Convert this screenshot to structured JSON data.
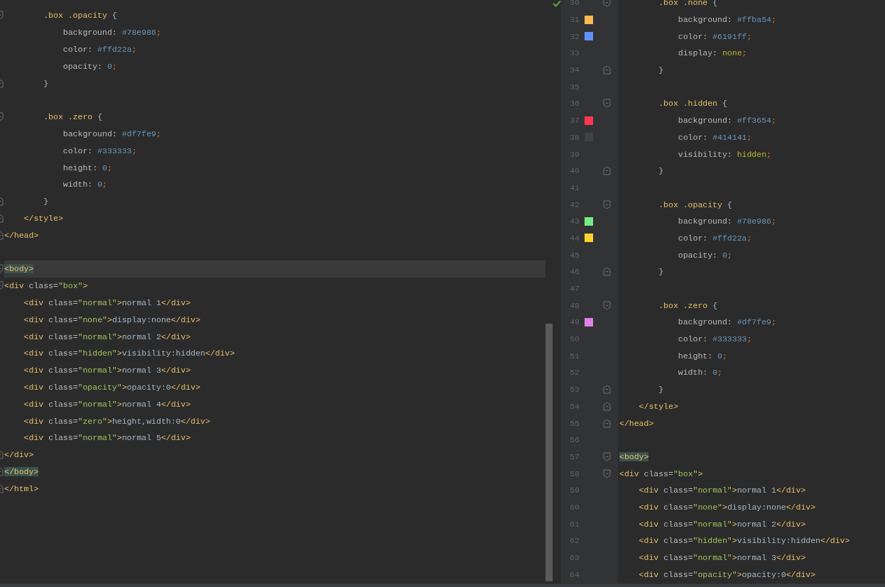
{
  "left_editor": {
    "lines": [
      {
        "kind": "opener",
        "current": false,
        "tokens": [
          {
            "kind": "sel",
            "text": "        .box .opacity"
          },
          {
            "kind": "text",
            "text": " {"
          }
        ]
      },
      {
        "kind": "plain",
        "current": false,
        "tokens": [
          {
            "kind": "prop",
            "text": "            background: "
          },
          {
            "kind": "hex",
            "text": "#78e986"
          },
          {
            "kind": "semi",
            "text": ";"
          }
        ]
      },
      {
        "kind": "plain",
        "current": false,
        "tokens": [
          {
            "kind": "prop",
            "text": "            color: "
          },
          {
            "kind": "hex",
            "text": "#ffd22a"
          },
          {
            "kind": "semi",
            "text": ";"
          }
        ]
      },
      {
        "kind": "plain",
        "current": false,
        "tokens": [
          {
            "kind": "prop",
            "text": "            opacity: "
          },
          {
            "kind": "hex",
            "text": "0"
          },
          {
            "kind": "semi",
            "text": ";"
          }
        ]
      },
      {
        "kind": "closer",
        "current": false,
        "tokens": [
          {
            "kind": "text",
            "text": "        }"
          }
        ]
      },
      {
        "kind": "plain",
        "current": false
      },
      {
        "kind": "opener",
        "current": false,
        "tokens": [
          {
            "kind": "sel",
            "text": "        .box .zero"
          },
          {
            "kind": "text",
            "text": " {"
          }
        ]
      },
      {
        "kind": "plain",
        "current": false,
        "tokens": [
          {
            "kind": "prop",
            "text": "            background: "
          },
          {
            "kind": "hex",
            "text": "#df7fe9"
          },
          {
            "kind": "semi",
            "text": ";"
          }
        ]
      },
      {
        "kind": "plain",
        "current": false,
        "tokens": [
          {
            "kind": "prop",
            "text": "            color: "
          },
          {
            "kind": "hex",
            "text": "#333333"
          },
          {
            "kind": "semi",
            "text": ";"
          }
        ]
      },
      {
        "kind": "plain",
        "current": false,
        "tokens": [
          {
            "kind": "prop",
            "text": "            height: "
          },
          {
            "kind": "hex",
            "text": "0"
          },
          {
            "kind": "semi",
            "text": ";"
          }
        ]
      },
      {
        "kind": "plain",
        "current": false,
        "tokens": [
          {
            "kind": "prop",
            "text": "            width: "
          },
          {
            "kind": "hex",
            "text": "0"
          },
          {
            "kind": "semi",
            "text": ";"
          }
        ]
      },
      {
        "kind": "closer",
        "current": false,
        "tokens": [
          {
            "kind": "text",
            "text": "        }"
          }
        ]
      },
      {
        "kind": "closer",
        "current": false,
        "tokens": [
          {
            "kind": "tag",
            "text": "    </style>"
          }
        ]
      },
      {
        "kind": "closer",
        "current": false,
        "tokens": [
          {
            "kind": "tag",
            "text": "</head>"
          }
        ]
      },
      {
        "kind": "plain",
        "current": false
      },
      {
        "kind": "opener",
        "current": true,
        "tokens": [
          {
            "kind": "match",
            "text": "<body>"
          }
        ]
      },
      {
        "kind": "opener",
        "current": false,
        "tokens": [
          {
            "kind": "tag",
            "text": "<div "
          },
          {
            "kind": "attr",
            "text": "class="
          },
          {
            "kind": "str",
            "text": "\"box\""
          },
          {
            "kind": "tag",
            "text": ">"
          }
        ]
      },
      {
        "kind": "plain",
        "current": false,
        "tokens": [
          {
            "kind": "tag",
            "text": "    <div "
          },
          {
            "kind": "attr",
            "text": "class="
          },
          {
            "kind": "str",
            "text": "\"normal\""
          },
          {
            "kind": "tag",
            "text": ">"
          },
          {
            "kind": "text",
            "text": "normal 1"
          },
          {
            "kind": "tag",
            "text": "</div>"
          }
        ]
      },
      {
        "kind": "plain",
        "current": false,
        "tokens": [
          {
            "kind": "tag",
            "text": "    <div "
          },
          {
            "kind": "attr",
            "text": "class="
          },
          {
            "kind": "str",
            "text": "\"none\""
          },
          {
            "kind": "tag",
            "text": ">"
          },
          {
            "kind": "text",
            "text": "display:none"
          },
          {
            "kind": "tag",
            "text": "</div>"
          }
        ]
      },
      {
        "kind": "plain",
        "current": false,
        "tokens": [
          {
            "kind": "tag",
            "text": "    <div "
          },
          {
            "kind": "attr",
            "text": "class="
          },
          {
            "kind": "str",
            "text": "\"normal\""
          },
          {
            "kind": "tag",
            "text": ">"
          },
          {
            "kind": "text",
            "text": "normal 2"
          },
          {
            "kind": "tag",
            "text": "</div>"
          }
        ]
      },
      {
        "kind": "plain",
        "current": false,
        "tokens": [
          {
            "kind": "tag",
            "text": "    <div "
          },
          {
            "kind": "attr",
            "text": "class="
          },
          {
            "kind": "str",
            "text": "\"hidden\""
          },
          {
            "kind": "tag",
            "text": ">"
          },
          {
            "kind": "text",
            "text": "visibility:hidden"
          },
          {
            "kind": "tag",
            "text": "</div>"
          }
        ]
      },
      {
        "kind": "plain",
        "current": false,
        "tokens": [
          {
            "kind": "tag",
            "text": "    <div "
          },
          {
            "kind": "attr",
            "text": "class="
          },
          {
            "kind": "str",
            "text": "\"normal\""
          },
          {
            "kind": "tag",
            "text": ">"
          },
          {
            "kind": "text",
            "text": "normal 3"
          },
          {
            "kind": "tag",
            "text": "</div>"
          }
        ]
      },
      {
        "kind": "plain",
        "current": false,
        "tokens": [
          {
            "kind": "tag",
            "text": "    <div "
          },
          {
            "kind": "attr",
            "text": "class="
          },
          {
            "kind": "str",
            "text": "\"opacity\""
          },
          {
            "kind": "tag",
            "text": ">"
          },
          {
            "kind": "text",
            "text": "opacity:0"
          },
          {
            "kind": "tag",
            "text": "</div>"
          }
        ]
      },
      {
        "kind": "plain",
        "current": false,
        "tokens": [
          {
            "kind": "tag",
            "text": "    <div "
          },
          {
            "kind": "attr",
            "text": "class="
          },
          {
            "kind": "str",
            "text": "\"normal\""
          },
          {
            "kind": "tag",
            "text": ">"
          },
          {
            "kind": "text",
            "text": "normal 4"
          },
          {
            "kind": "tag",
            "text": "</div>"
          }
        ]
      },
      {
        "kind": "plain",
        "current": false,
        "tokens": [
          {
            "kind": "tag",
            "text": "    <div "
          },
          {
            "kind": "attr",
            "text": "class="
          },
          {
            "kind": "str",
            "text": "\"zero\""
          },
          {
            "kind": "tag",
            "text": ">"
          },
          {
            "kind": "text",
            "text": "height,width:0"
          },
          {
            "kind": "tag",
            "text": "</div>"
          }
        ]
      },
      {
        "kind": "plain",
        "current": false,
        "tokens": [
          {
            "kind": "tag",
            "text": "    <div "
          },
          {
            "kind": "attr",
            "text": "class="
          },
          {
            "kind": "str",
            "text": "\"normal\""
          },
          {
            "kind": "tag",
            "text": ">"
          },
          {
            "kind": "text",
            "text": "normal 5"
          },
          {
            "kind": "tag",
            "text": "</div>"
          }
        ]
      },
      {
        "kind": "closer",
        "current": false,
        "tokens": [
          {
            "kind": "tag",
            "text": "</div>"
          }
        ]
      },
      {
        "kind": "closer",
        "current": false,
        "tokens": [
          {
            "kind": "match",
            "text": "</body>"
          }
        ]
      },
      {
        "kind": "closer",
        "current": false,
        "tokens": [
          {
            "kind": "tag",
            "text": "</html>"
          }
        ]
      }
    ]
  },
  "right_editor": {
    "lines": [
      {
        "number": "30",
        "kind": "opener",
        "tokens": [
          {
            "kind": "sel",
            "text": "        .box .none"
          },
          {
            "kind": "text",
            "text": " {"
          }
        ]
      },
      {
        "number": "31",
        "kind": "plain",
        "color": "#ffba54",
        "tokens": [
          {
            "kind": "prop",
            "text": "            background: "
          },
          {
            "kind": "hex",
            "text": "#ffba54"
          },
          {
            "kind": "semi",
            "text": ";"
          }
        ]
      },
      {
        "number": "32",
        "kind": "plain",
        "color": "#6191ff",
        "tokens": [
          {
            "kind": "prop",
            "text": "            color: "
          },
          {
            "kind": "hex",
            "text": "#6191ff"
          },
          {
            "kind": "semi",
            "text": ";"
          }
        ]
      },
      {
        "number": "33",
        "kind": "plain",
        "tokens": [
          {
            "kind": "prop",
            "text": "            display: "
          },
          {
            "kind": "kw",
            "text": "none"
          },
          {
            "kind": "semi",
            "text": ";"
          }
        ]
      },
      {
        "number": "34",
        "kind": "closer",
        "tokens": [
          {
            "kind": "text",
            "text": "        }"
          }
        ]
      },
      {
        "number": "35",
        "kind": "plain"
      },
      {
        "number": "36",
        "kind": "opener",
        "tokens": [
          {
            "kind": "sel",
            "text": "        .box .hidden"
          },
          {
            "kind": "text",
            "text": " {"
          }
        ]
      },
      {
        "number": "37",
        "kind": "plain",
        "color": "#ff3654",
        "tokens": [
          {
            "kind": "prop",
            "text": "            background: "
          },
          {
            "kind": "hex",
            "text": "#ff3654"
          },
          {
            "kind": "semi",
            "text": ";"
          }
        ]
      },
      {
        "number": "38",
        "kind": "plain",
        "color": "#414141",
        "tokens": [
          {
            "kind": "prop",
            "text": "            color: "
          },
          {
            "kind": "hex",
            "text": "#414141"
          },
          {
            "kind": "semi",
            "text": ";"
          }
        ]
      },
      {
        "number": "39",
        "kind": "plain",
        "tokens": [
          {
            "kind": "prop",
            "text": "            visibility: "
          },
          {
            "kind": "kw",
            "text": "hidden"
          },
          {
            "kind": "semi",
            "text": ";"
          }
        ]
      },
      {
        "number": "40",
        "kind": "closer",
        "tokens": [
          {
            "kind": "text",
            "text": "        }"
          }
        ]
      },
      {
        "number": "41",
        "kind": "plain"
      },
      {
        "number": "42",
        "kind": "opener",
        "tokens": [
          {
            "kind": "sel",
            "text": "        .box .opacity"
          },
          {
            "kind": "text",
            "text": " {"
          }
        ]
      },
      {
        "number": "43",
        "kind": "plain",
        "color": "#78e986",
        "tokens": [
          {
            "kind": "prop",
            "text": "            background: "
          },
          {
            "kind": "hex",
            "text": "#78e986"
          },
          {
            "kind": "semi",
            "text": ";"
          }
        ]
      },
      {
        "number": "44",
        "kind": "plain",
        "color": "#ffd22a",
        "tokens": [
          {
            "kind": "prop",
            "text": "            color: "
          },
          {
            "kind": "hex",
            "text": "#ffd22a"
          },
          {
            "kind": "semi",
            "text": ";"
          }
        ]
      },
      {
        "number": "45",
        "kind": "plain",
        "tokens": [
          {
            "kind": "prop",
            "text": "            opacity: "
          },
          {
            "kind": "hex",
            "text": "0"
          },
          {
            "kind": "semi",
            "text": ";"
          }
        ]
      },
      {
        "number": "46",
        "kind": "closer",
        "tokens": [
          {
            "kind": "text",
            "text": "        }"
          }
        ]
      },
      {
        "number": "47",
        "kind": "plain"
      },
      {
        "number": "48",
        "kind": "opener",
        "tokens": [
          {
            "kind": "sel",
            "text": "        .box .zero"
          },
          {
            "kind": "text",
            "text": " {"
          }
        ]
      },
      {
        "number": "49",
        "kind": "plain",
        "color": "#df7fe9",
        "tokens": [
          {
            "kind": "prop",
            "text": "            background: "
          },
          {
            "kind": "hex",
            "text": "#df7fe9"
          },
          {
            "kind": "semi",
            "text": ";"
          }
        ]
      },
      {
        "number": "50",
        "kind": "plain",
        "tokens": [
          {
            "kind": "prop",
            "text": "            color: "
          },
          {
            "kind": "hex",
            "text": "#333333"
          },
          {
            "kind": "semi",
            "text": ";"
          }
        ]
      },
      {
        "number": "51",
        "kind": "plain",
        "tokens": [
          {
            "kind": "prop",
            "text": "            height: "
          },
          {
            "kind": "hex",
            "text": "0"
          },
          {
            "kind": "semi",
            "text": ";"
          }
        ]
      },
      {
        "number": "52",
        "kind": "plain",
        "tokens": [
          {
            "kind": "prop",
            "text": "            width: "
          },
          {
            "kind": "hex",
            "text": "0"
          },
          {
            "kind": "semi",
            "text": ";"
          }
        ]
      },
      {
        "number": "53",
        "kind": "closer",
        "tokens": [
          {
            "kind": "text",
            "text": "        }"
          }
        ]
      },
      {
        "number": "54",
        "kind": "closer",
        "tokens": [
          {
            "kind": "tag",
            "text": "    </style>"
          }
        ]
      },
      {
        "number": "55",
        "kind": "closer",
        "tokens": [
          {
            "kind": "tag",
            "text": "</head>"
          }
        ]
      },
      {
        "number": "56",
        "kind": "plain"
      },
      {
        "number": "57",
        "kind": "opener",
        "tokens": [
          {
            "kind": "match",
            "text": "<body>"
          }
        ]
      },
      {
        "number": "58",
        "kind": "opener",
        "tokens": [
          {
            "kind": "tag",
            "text": "<div "
          },
          {
            "kind": "attr",
            "text": "class="
          },
          {
            "kind": "str",
            "text": "\"box\""
          },
          {
            "kind": "tag",
            "text": ">"
          }
        ]
      },
      {
        "number": "59",
        "kind": "plain",
        "tokens": [
          {
            "kind": "tag",
            "text": "    <div "
          },
          {
            "kind": "attr",
            "text": "class="
          },
          {
            "kind": "str",
            "text": "\"normal\""
          },
          {
            "kind": "tag",
            "text": ">"
          },
          {
            "kind": "text",
            "text": "normal 1"
          },
          {
            "kind": "tag",
            "text": "</div>"
          }
        ]
      },
      {
        "number": "60",
        "kind": "plain",
        "tokens": [
          {
            "kind": "tag",
            "text": "    <div "
          },
          {
            "kind": "attr",
            "text": "class="
          },
          {
            "kind": "str",
            "text": "\"none\""
          },
          {
            "kind": "tag",
            "text": ">"
          },
          {
            "kind": "text",
            "text": "display:none"
          },
          {
            "kind": "tag",
            "text": "</div>"
          }
        ]
      },
      {
        "number": "61",
        "kind": "plain",
        "tokens": [
          {
            "kind": "tag",
            "text": "    <div "
          },
          {
            "kind": "attr",
            "text": "class="
          },
          {
            "kind": "str",
            "text": "\"normal\""
          },
          {
            "kind": "tag",
            "text": ">"
          },
          {
            "kind": "text",
            "text": "normal 2"
          },
          {
            "kind": "tag",
            "text": "</div>"
          }
        ]
      },
      {
        "number": "62",
        "kind": "plain",
        "tokens": [
          {
            "kind": "tag",
            "text": "    <div "
          },
          {
            "kind": "attr",
            "text": "class="
          },
          {
            "kind": "str",
            "text": "\"hidden\""
          },
          {
            "kind": "tag",
            "text": ">"
          },
          {
            "kind": "text",
            "text": "visibility:hidden"
          },
          {
            "kind": "tag",
            "text": "</div>"
          }
        ]
      },
      {
        "number": "63",
        "kind": "plain",
        "tokens": [
          {
            "kind": "tag",
            "text": "    <div "
          },
          {
            "kind": "attr",
            "text": "class="
          },
          {
            "kind": "str",
            "text": "\"normal\""
          },
          {
            "kind": "tag",
            "text": ">"
          },
          {
            "kind": "text",
            "text": "normal 3"
          },
          {
            "kind": "tag",
            "text": "</div>"
          }
        ]
      },
      {
        "number": "64",
        "kind": "plain",
        "tokens": [
          {
            "kind": "tag",
            "text": "    <div "
          },
          {
            "kind": "attr",
            "text": "class="
          },
          {
            "kind": "str",
            "text": "\"opacity\""
          },
          {
            "kind": "tag",
            "text": ">"
          },
          {
            "kind": "text",
            "text": "opacity:0"
          },
          {
            "kind": "tag",
            "text": "</div>"
          }
        ]
      }
    ]
  }
}
